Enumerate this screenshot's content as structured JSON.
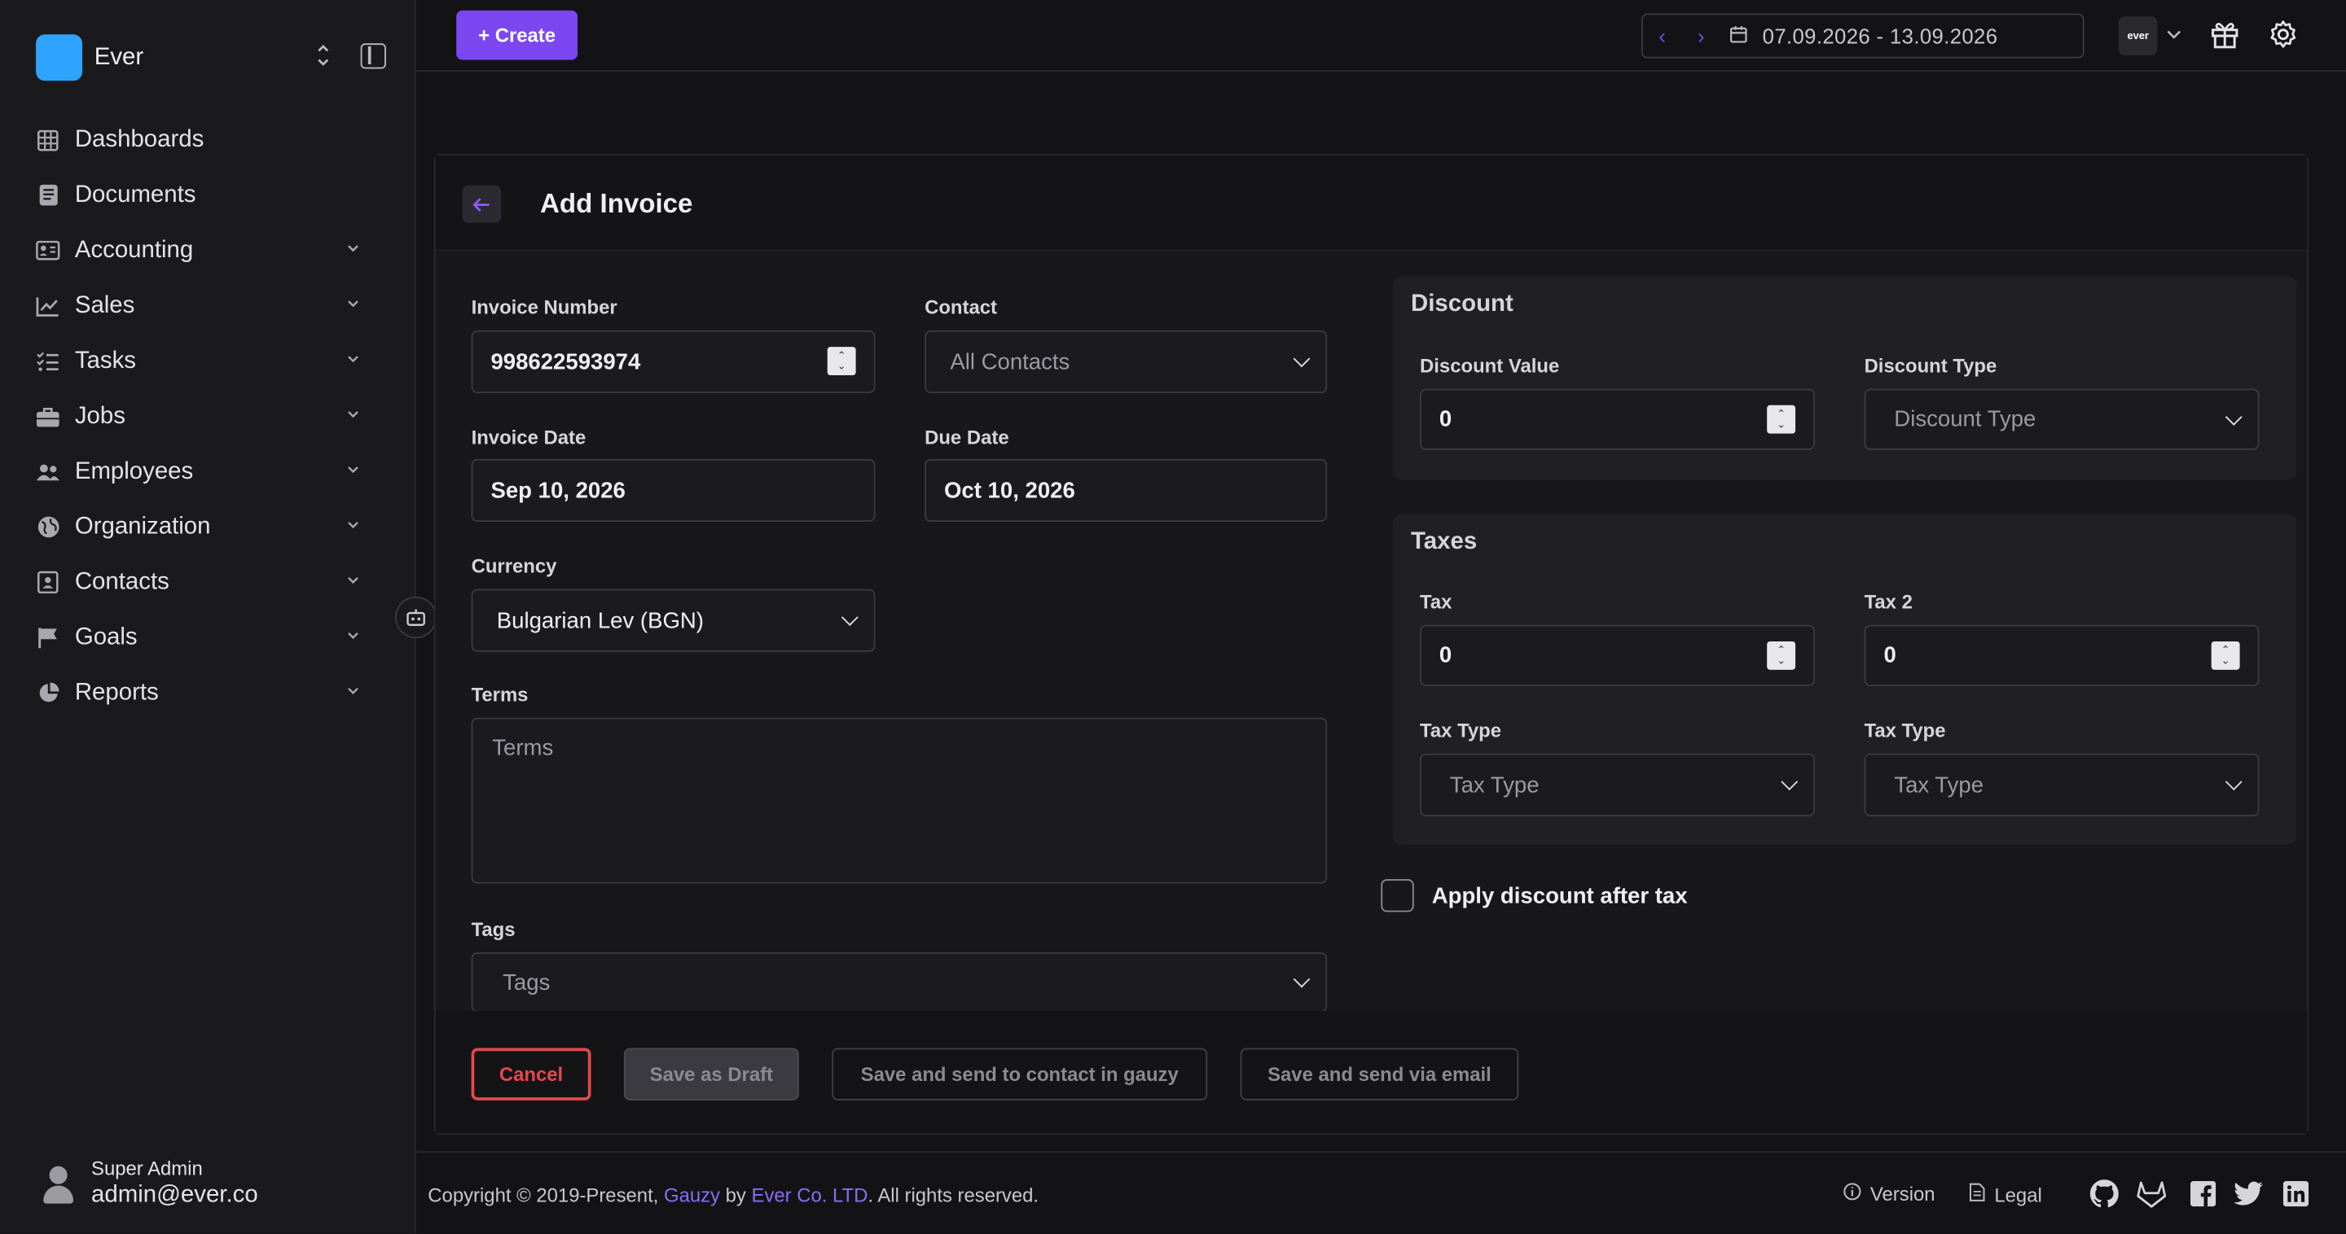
{
  "brand": {
    "name": "Ever",
    "color": "#2fa4ff"
  },
  "sidebar": {
    "items": [
      {
        "label": "Dashboards",
        "icon": "grid-icon",
        "expandable": false
      },
      {
        "label": "Documents",
        "icon": "document-icon",
        "expandable": false
      },
      {
        "label": "Accounting",
        "icon": "id-card-icon",
        "expandable": true
      },
      {
        "label": "Sales",
        "icon": "chart-line-icon",
        "expandable": true
      },
      {
        "label": "Tasks",
        "icon": "task-list-icon",
        "expandable": true
      },
      {
        "label": "Jobs",
        "icon": "briefcase-icon",
        "expandable": true
      },
      {
        "label": "Employees",
        "icon": "users-icon",
        "expandable": true
      },
      {
        "label": "Organization",
        "icon": "globe-icon",
        "expandable": true
      },
      {
        "label": "Contacts",
        "icon": "contact-book-icon",
        "expandable": true
      },
      {
        "label": "Goals",
        "icon": "flag-icon",
        "expandable": true
      },
      {
        "label": "Reports",
        "icon": "pie-chart-icon",
        "expandable": true
      }
    ]
  },
  "user": {
    "name": "Super Admin",
    "email": "admin@ever.co"
  },
  "topbar": {
    "create_label": "+ Create",
    "date_range": "07.09.2026 - 13.09.2026",
    "org_logo_text": "ever",
    "accent": "#7c47f1"
  },
  "form": {
    "title": "Add Invoice",
    "invoice_number": {
      "label": "Invoice Number",
      "value": "998622593974"
    },
    "contact": {
      "label": "Contact",
      "value": "All Contacts"
    },
    "invoice_date": {
      "label": "Invoice Date",
      "value": "Sep 10, 2026"
    },
    "due_date": {
      "label": "Due Date",
      "value": "Oct 10, 2026"
    },
    "currency": {
      "label": "Currency",
      "value": "Bulgarian Lev (BGN)"
    },
    "terms": {
      "label": "Terms",
      "placeholder": "Terms"
    },
    "tags": {
      "label": "Tags",
      "placeholder": "Tags"
    },
    "discount": {
      "title": "Discount",
      "value_label": "Discount Value",
      "value": "0",
      "type_label": "Discount Type",
      "type_placeholder": "Discount Type"
    },
    "taxes": {
      "title": "Taxes",
      "tax_label": "Tax",
      "tax_value": "0",
      "tax2_label": "Tax 2",
      "tax2_value": "0",
      "tax_type_label": "Tax Type",
      "tax_type_placeholder": "Tax Type",
      "tax_type2_label": "Tax Type",
      "tax_type2_placeholder": "Tax Type"
    },
    "apply_discount_label": "Apply discount after tax",
    "buttons": {
      "cancel": "Cancel",
      "draft": "Save as Draft",
      "send_gauzy": "Save and send to contact in gauzy",
      "send_email": "Save and send via email"
    }
  },
  "footer": {
    "copyright_prefix": "Copyright © 2019-Present, ",
    "gauzy": "Gauzy",
    "by": " by ",
    "company": "Ever Co. LTD",
    "suffix": ". All rights reserved.",
    "version": "Version",
    "legal": "Legal",
    "social": [
      "github-icon",
      "gitlab-icon",
      "facebook-icon",
      "twitter-icon",
      "linkedin-icon"
    ]
  }
}
